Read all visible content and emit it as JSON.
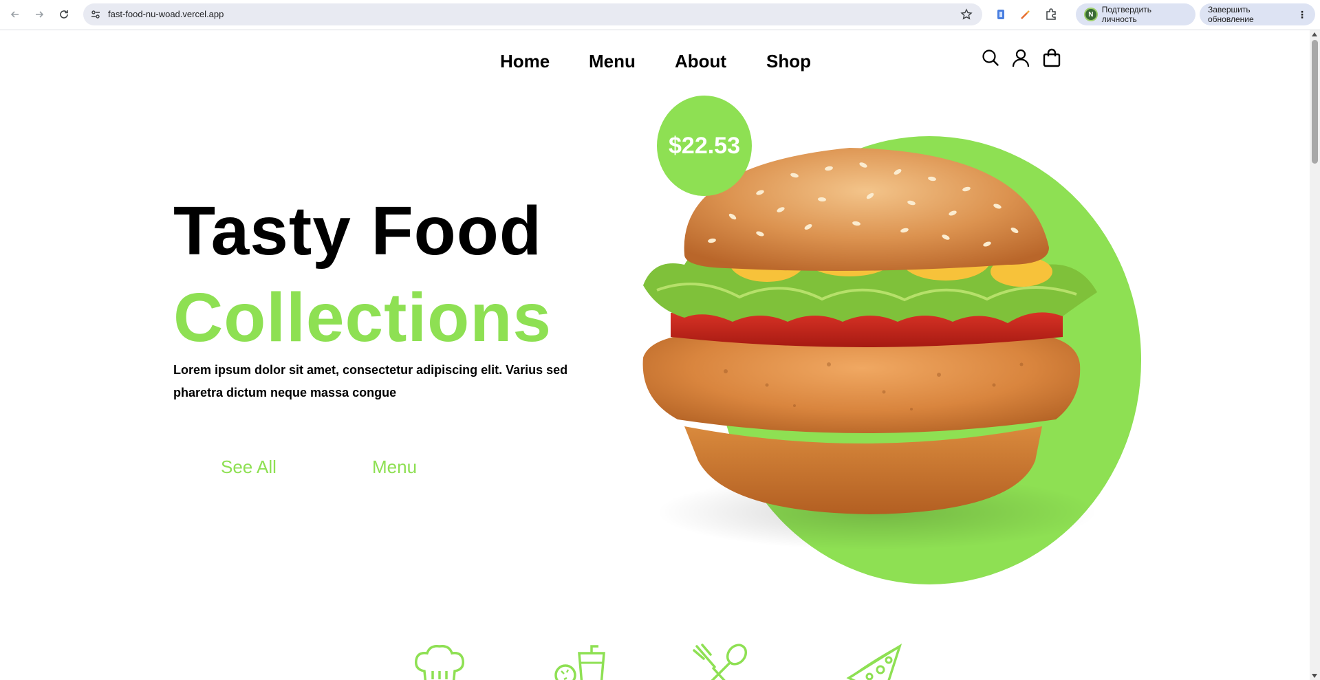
{
  "browser": {
    "url": "fast-food-nu-woad.vercel.app",
    "profile_initial": "N",
    "verify_label": "Подтвердить личность",
    "update_label": "Завершить обновление"
  },
  "nav": {
    "items": [
      "Home",
      "Menu",
      "About",
      "Shop"
    ]
  },
  "hero": {
    "title": "Tasty Food",
    "subtitle": "Collections",
    "description": "Lorem ipsum dolor sit amet, consectetur adipiscing elit. Varius sed pharetra dictum neque massa congue",
    "buttons": [
      "See All",
      "Menu"
    ],
    "price": "$22.53"
  },
  "colors": {
    "accent": "#8ee053",
    "text": "#000000"
  },
  "icons": {
    "header": [
      "search-icon",
      "user-icon",
      "shopping-bag-icon"
    ],
    "features": [
      "chef-hat-icon",
      "meal-icon",
      "fork-spoon-icon",
      "pizza-slice-icon"
    ]
  }
}
